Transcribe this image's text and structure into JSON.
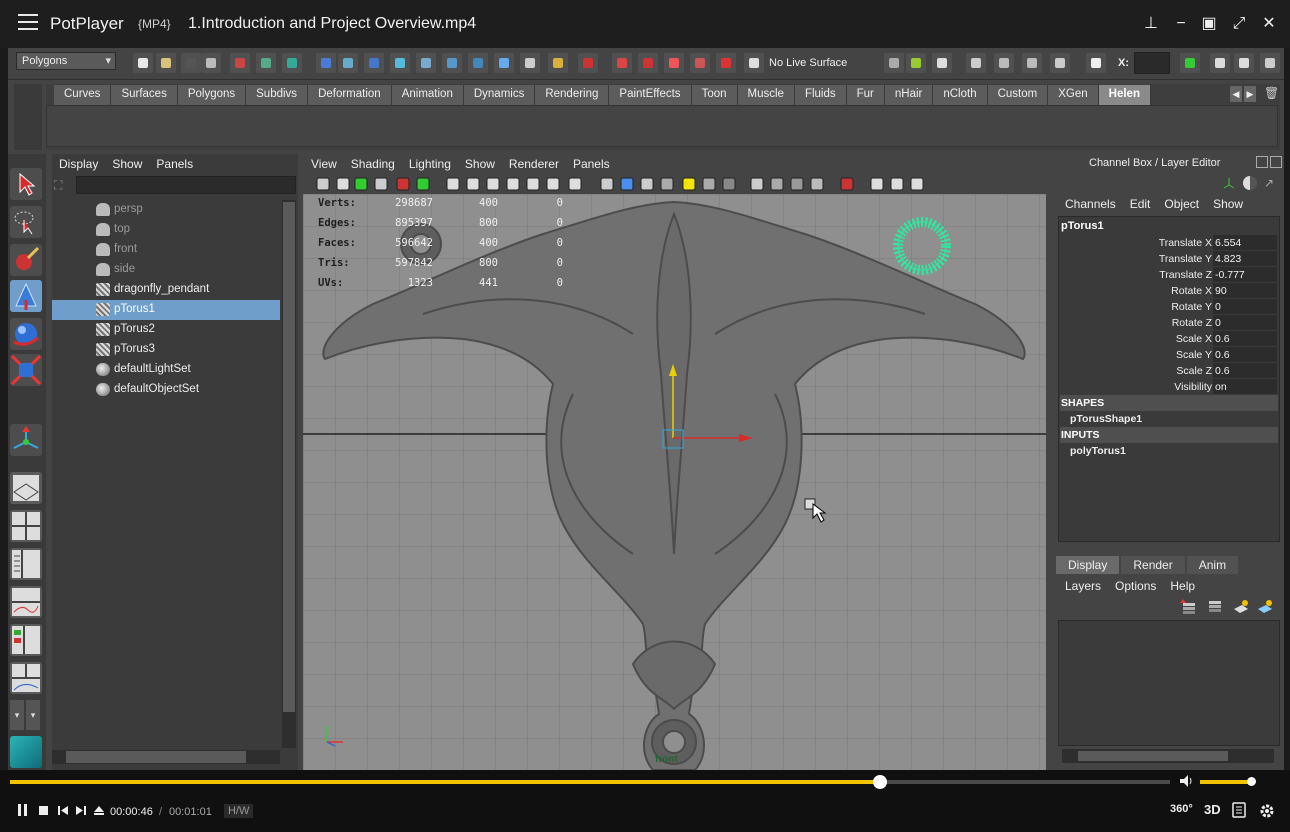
{
  "titlebar": {
    "app_name": "PotPlayer",
    "format": "{MP4}",
    "filename": "1.Introduction and Project Overview.mp4",
    "buttons": [
      "pin-icon",
      "minimize-icon",
      "maximize-icon",
      "fullscreen-icon",
      "close-icon"
    ]
  },
  "statusline": {
    "menu_set": "Polygons",
    "live_surface": "No Live Surface",
    "x_label": "X:"
  },
  "shelf": {
    "tabs": [
      "Curves",
      "Surfaces",
      "Polygons",
      "Subdivs",
      "Deformation",
      "Animation",
      "Dynamics",
      "Rendering",
      "PaintEffects",
      "Toon",
      "Muscle",
      "Fluids",
      "Fur",
      "nHair",
      "nCloth",
      "Custom",
      "XGen",
      "Helen"
    ],
    "active_tab": "Helen"
  },
  "outliner": {
    "menu": [
      "Display",
      "Show",
      "Panels"
    ],
    "items": [
      {
        "label": "persp",
        "dim": true,
        "icon": "camera-icon"
      },
      {
        "label": "top",
        "dim": true,
        "icon": "camera-icon"
      },
      {
        "label": "front",
        "dim": true,
        "icon": "camera-icon"
      },
      {
        "label": "side",
        "dim": true,
        "icon": "camera-icon"
      },
      {
        "label": "dragonfly_pendant",
        "dim": false,
        "icon": "mesh-icon"
      },
      {
        "label": "pTorus1",
        "dim": false,
        "selected": true,
        "icon": "mesh-icon"
      },
      {
        "label": "pTorus2",
        "dim": false,
        "icon": "mesh-icon"
      },
      {
        "label": "pTorus3",
        "dim": false,
        "icon": "mesh-icon"
      },
      {
        "label": "defaultLightSet",
        "dim": false,
        "icon": "set-icon"
      },
      {
        "label": "defaultObjectSet",
        "dim": false,
        "icon": "set-icon"
      }
    ]
  },
  "viewport": {
    "menu": [
      "View",
      "Shading",
      "Lighting",
      "Show",
      "Renderer",
      "Panels"
    ],
    "hud": [
      {
        "label": "Verts:",
        "v1": "298687",
        "v2": "400",
        "v3": "0"
      },
      {
        "label": "Edges:",
        "v1": "895397",
        "v2": "800",
        "v3": "0"
      },
      {
        "label": "Faces:",
        "v1": "596642",
        "v2": "400",
        "v3": "0"
      },
      {
        "label": "Tris:",
        "v1": "597842",
        "v2": "800",
        "v3": "0"
      },
      {
        "label": "UVs:",
        "v1": "1323",
        "v2": "441",
        "v3": "0"
      }
    ],
    "camera_label": "front"
  },
  "channel_box": {
    "title": "Channel Box / Layer Editor",
    "menu": [
      "Channels",
      "Edit",
      "Object",
      "Show"
    ],
    "object": "pTorus1",
    "channels": [
      {
        "label": "Translate X",
        "value": "6.554"
      },
      {
        "label": "Translate Y",
        "value": "4.823"
      },
      {
        "label": "Translate Z",
        "value": "-0.777"
      },
      {
        "label": "Rotate X",
        "value": "90"
      },
      {
        "label": "Rotate Y",
        "value": "0"
      },
      {
        "label": "Rotate Z",
        "value": "0"
      },
      {
        "label": "Scale X",
        "value": "0.6"
      },
      {
        "label": "Scale Y",
        "value": "0.6"
      },
      {
        "label": "Scale Z",
        "value": "0.6"
      },
      {
        "label": "Visibility",
        "value": "on"
      }
    ],
    "shapes_label": "SHAPES",
    "shape_node": "pTorusShape1",
    "inputs_label": "INPUTS",
    "input_node": "polyTorus1"
  },
  "layer_editor": {
    "tabs": [
      "Display",
      "Render",
      "Anim"
    ],
    "active_tab": "Display",
    "menu": [
      "Layers",
      "Options",
      "Help"
    ]
  },
  "player": {
    "current_time": "00:00:46",
    "total_time": "00:01:01",
    "hw_label": "H/W",
    "progress": 0.75,
    "volume": 0.95,
    "badge_360": "360°",
    "badge_3d": "3D"
  },
  "colors": {
    "accent": "#f2c100",
    "selection": "#6e9ec9",
    "torus_highlight": "#2fe8a0"
  }
}
